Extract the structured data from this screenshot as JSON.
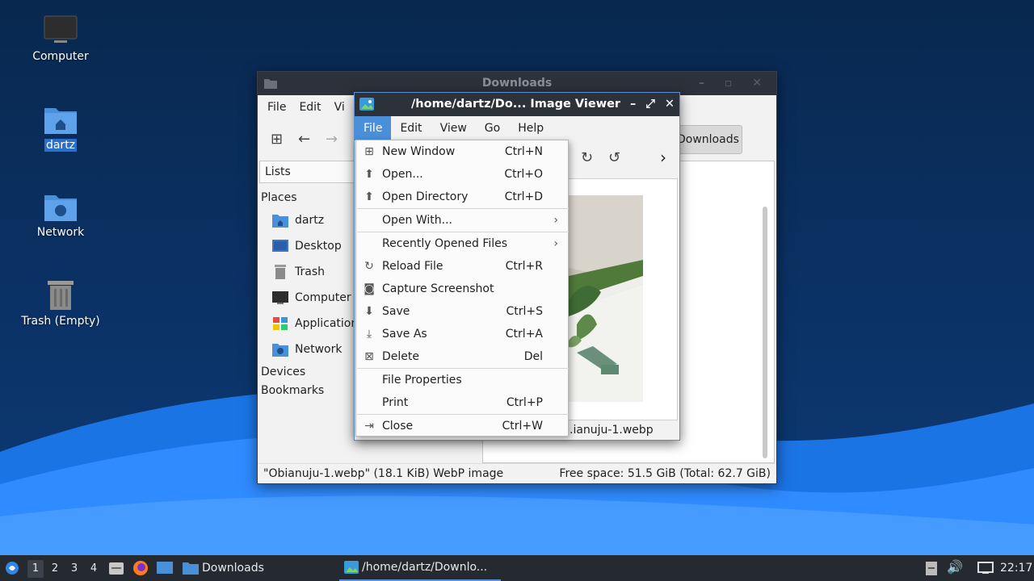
{
  "desktop": {
    "icons": [
      {
        "label": "Computer"
      },
      {
        "label": "dartz"
      },
      {
        "label": "Network"
      },
      {
        "label": "Trash (Empty)"
      }
    ]
  },
  "thunar": {
    "title": "Downloads",
    "menu": [
      "File",
      "Edit",
      "Vi"
    ],
    "location_button": "Downloads",
    "sidebar": {
      "view_selector": "Lists",
      "places_header": "Places",
      "places": [
        "dartz",
        "Desktop",
        "Trash",
        "Computer",
        "Application",
        "Network"
      ],
      "devices_header": "Devices",
      "bookmarks_header": "Bookmarks"
    },
    "status_left": "\"Obianuju-1.webp\" (18.1 KiB) WebP image",
    "status_right": "Free space: 51.5 GiB (Total: 62.7 GiB)"
  },
  "viewer": {
    "title": "/home/dartz/Do... Image Viewer",
    "menu": [
      "File",
      "Edit",
      "View",
      "Go",
      "Help"
    ],
    "active_menu": "File",
    "filename": ".ianuju-1.webp"
  },
  "file_menu": [
    {
      "icon": "new-window-icon",
      "label": "New Window",
      "accel": "Ctrl+N"
    },
    {
      "icon": "open-icon",
      "label": "Open...",
      "accel": "Ctrl+O"
    },
    {
      "icon": "open-directory-icon",
      "label": "Open Directory",
      "accel": "Ctrl+D"
    },
    {
      "icon": "",
      "label": "Open With...",
      "accel": "",
      "submenu": true
    },
    {
      "icon": "",
      "label": "Recently Opened Files",
      "accel": "",
      "submenu": true
    },
    {
      "icon": "reload-icon",
      "label": "Reload File",
      "accel": "Ctrl+R"
    },
    {
      "icon": "camera-icon",
      "label": "Capture Screenshot",
      "accel": ""
    },
    {
      "icon": "save-icon",
      "label": "Save",
      "accel": "Ctrl+S"
    },
    {
      "icon": "save-as-icon",
      "label": "Save As",
      "accel": "Ctrl+A"
    },
    {
      "icon": "delete-icon",
      "label": "Delete",
      "accel": "Del"
    },
    {
      "icon": "",
      "label": "File Properties",
      "accel": ""
    },
    {
      "icon": "",
      "label": "Print",
      "accel": "Ctrl+P"
    },
    {
      "icon": "close-icon",
      "label": "Close",
      "accel": "Ctrl+W"
    }
  ],
  "taskbar": {
    "workspaces": [
      "1",
      "2",
      "3",
      "4"
    ],
    "current_workspace": "1",
    "tasks": [
      "Downloads",
      "/home/dartz/Downlo..."
    ],
    "clock": "22:17"
  }
}
